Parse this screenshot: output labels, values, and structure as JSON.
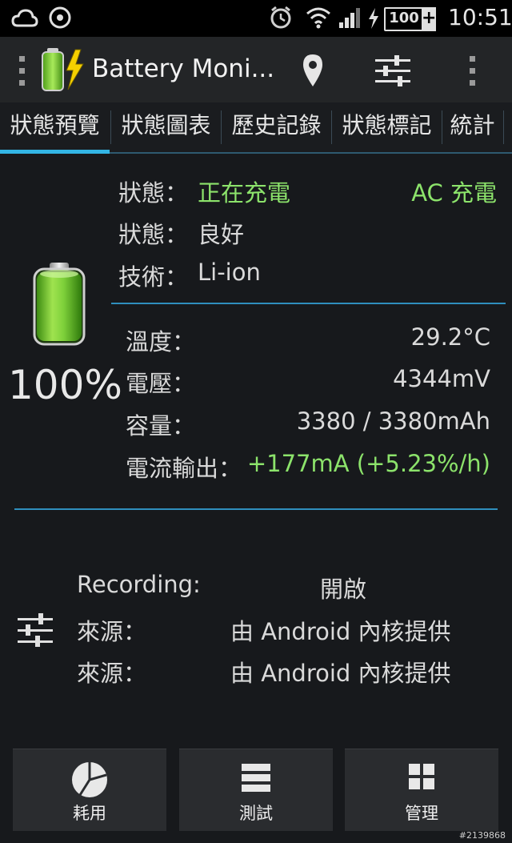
{
  "status_bar": {
    "time": "10:51",
    "battery_level": "100"
  },
  "action_bar": {
    "title": "Battery Moni..."
  },
  "tabs": [
    {
      "label": "狀態預覽",
      "active": true
    },
    {
      "label": "狀態圖表"
    },
    {
      "label": "歷史記錄"
    },
    {
      "label": "狀態標記"
    },
    {
      "label": "統計"
    }
  ],
  "battery": {
    "percent": "100%",
    "level_fraction": 1.0
  },
  "status_section": {
    "status_label": "狀態：",
    "status_value": "正在充電",
    "charge_source": "AC 充電",
    "health_label": "狀態：",
    "health_value": "良好",
    "tech_label": "技術：",
    "tech_value": "Li-ion"
  },
  "metrics": {
    "temp_label": "溫度：",
    "temp_value": "29.2°C",
    "voltage_label": "電壓：",
    "voltage_value": "4344mV",
    "capacity_label": "容量：",
    "capacity_value": "3380 / 3380mAh",
    "current_label": "電流輸出：",
    "current_value": "+177mA (+5.23%/h)"
  },
  "recording": {
    "recording_label": "Recording:",
    "recording_value": "開啟",
    "source1_label": "來源：",
    "source1_value": "由 Android 內核提供",
    "source2_label": "來源：",
    "source2_value": "由 Android 內核提供"
  },
  "bottom_buttons": {
    "usage": "耗用",
    "test": "測試",
    "manage": "管理"
  },
  "watermark": "#2139868",
  "colors": {
    "accent": "#33b5e5",
    "green_text": "#8ce36b",
    "divider": "#2f8fbd"
  }
}
